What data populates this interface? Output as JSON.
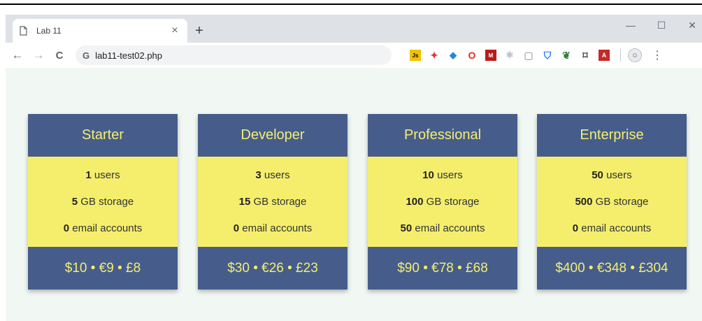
{
  "browser": {
    "tab_title": "Lab 11",
    "tab_close": "×",
    "new_tab": "+",
    "minimize": "—",
    "maximize": "☐",
    "close": "✕",
    "back": "←",
    "forward": "→",
    "reload": "C",
    "omnibox_icon": "G",
    "url": "lab11-test02.php",
    "menu": "⋮",
    "extensions": [
      {
        "name": "js-icon",
        "glyph": "Js"
      },
      {
        "name": "color-wheel-icon",
        "glyph": "✦"
      },
      {
        "name": "gem-icon",
        "glyph": "◆"
      },
      {
        "name": "opera-icon",
        "glyph": "O"
      },
      {
        "name": "monitor-icon",
        "glyph": "M"
      },
      {
        "name": "react-icon",
        "glyph": "⚛"
      },
      {
        "name": "dashed-box-icon",
        "glyph": "▢"
      },
      {
        "name": "shield-icon",
        "glyph": "⛉"
      },
      {
        "name": "evernote-icon",
        "glyph": "❦"
      },
      {
        "name": "screenshot-icon",
        "glyph": "⌑"
      },
      {
        "name": "pdf-icon",
        "glyph": "A"
      }
    ],
    "avatar_glyph": "☺"
  },
  "plans": [
    {
      "name": "Starter",
      "users": "1",
      "users_label": " users",
      "storage": "5",
      "storage_label": " GB storage",
      "email": "0",
      "email_label": " email accounts",
      "price": "$10 • €9 • £8"
    },
    {
      "name": "Developer",
      "users": "3",
      "users_label": " users",
      "storage": "15",
      "storage_label": " GB storage",
      "email": "0",
      "email_label": " email accounts",
      "price": "$30 • €26 • £23"
    },
    {
      "name": "Professional",
      "users": "10",
      "users_label": " users",
      "storage": "100",
      "storage_label": " GB storage",
      "email": "50",
      "email_label": " email accounts",
      "price": "$90 • €78 • £68"
    },
    {
      "name": "Enterprise",
      "users": "50",
      "users_label": " users",
      "storage": "500",
      "storage_label": " GB storage",
      "email": "0",
      "email_label": " email accounts",
      "price": "$400 • €348 • £304"
    }
  ],
  "colors": {
    "card_header": "#465d8b",
    "card_body": "#f5ee6c",
    "card_text_accent": "#f4ee72",
    "page_background": "#f1f8f3"
  }
}
